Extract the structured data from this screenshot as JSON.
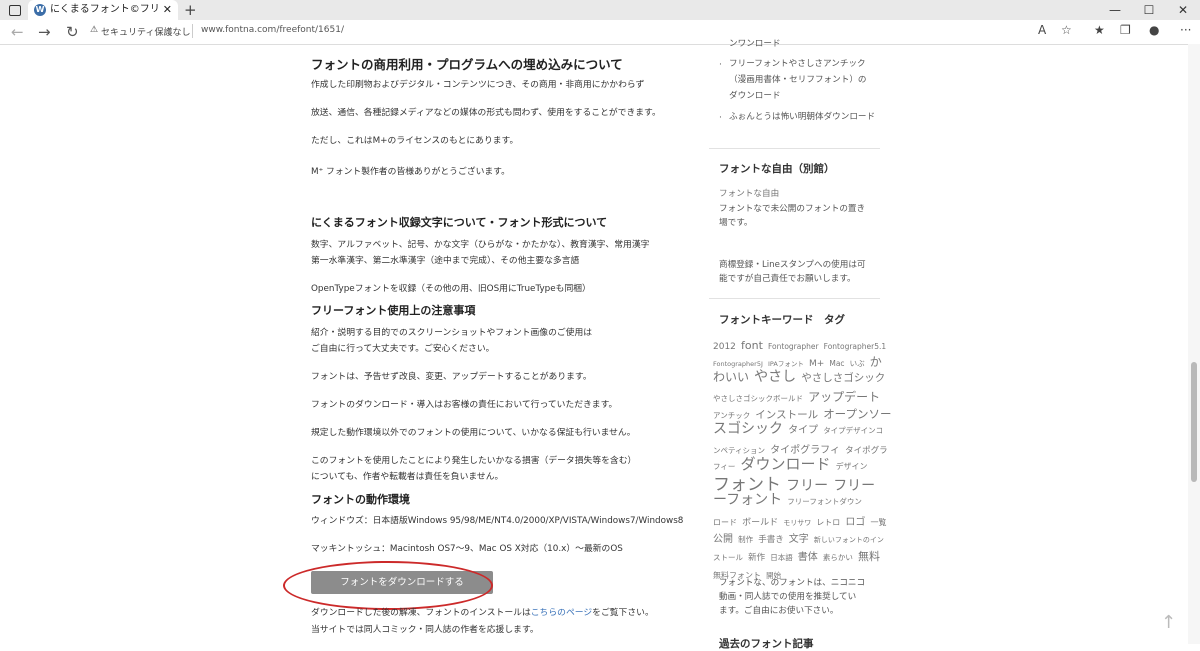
{
  "browser": {
    "tab_title": "にくまるフォント©フリーフォントダウンロ",
    "tab_close": "✕",
    "new_tab": "+",
    "security_label": "セキュリティ保護なし",
    "url": "www.fontna.com/freefont/1651/",
    "window_controls": [
      "—",
      "☐",
      "✕"
    ]
  },
  "main": {
    "h1": "フォントの商用利用・プログラムへの埋め込みについて",
    "p1": "作成した印刷物およびデジタル・コンテンツにつき、その商用・非商用にかかわらず",
    "p2": "放送、通信、各種記録メディアなどの媒体の形式も問わず、使用をすることができます。",
    "p3": "ただし、これはM+のライセンスのもとにあります。",
    "p4": "M⁺ フォント製作者の皆様ありがとうございます。",
    "h2": "にくまるフォント収録文字について・フォント形式について",
    "p5a": "数字、アルファベット、記号、かな文字（ひらがな・かたかな）、教育漢字、常用漢字",
    "p5b": "第一水準漢字、第二水準漢字（途中まで完成）、その他主要な多言語",
    "p6": "OpenTypeフォントを収録（その他の用、旧OS用にTrueTypeも同梱）",
    "h3": "フリーフォント使用上の注意事項",
    "p7a": "紹介・説明する目的でのスクリーンショットやフォント画像のご使用は",
    "p7b": "ご自由に行って大丈夫です。ご安心ください。",
    "p8": "フォントは、予告せず改良、変更、アップデートすることがあります。",
    "p9": "フォントのダウンロード・導入はお客様の責任において行っていただきます。",
    "p10": "規定した動作環境以外でのフォントの使用について、いかなる保証も行いません。",
    "p11a": "このフォントを使用したことにより発生したいかなる損害（データ損失等を含む）",
    "p11b": "についても、作者や転載者は責任を負いません。",
    "h4": "フォントの動作環境",
    "p12": "ウィンドウズ：日本語版Windows 95/98/ME/NT4.0/2000/XP/VISTA/Windows7/Windows8",
    "p13": "マッキントッシュ：Macintosh OS7～9、Mac OS X対応（10.x）～最新のOS",
    "download_button": "フォントをダウンロードする",
    "p14_pre": "ダウンロードした後の解凍、フォントのインストールは",
    "p14_link": "こちらのページ",
    "p14_post": "をご覧下さい。",
    "p15": "当サイトでは同人コミック・同人誌の作者を応援します。"
  },
  "sidebar": {
    "top_cut": "ンワンロード",
    "link1a": "フリーフォントやさしさアンチック",
    "link1b": "（漫画用書体・セリフフォント）の",
    "link1c": "ダウンロード",
    "link2": "ふぉんとうは怖い明朝体ダウンロード",
    "h_free": "フォントな自由（別館）",
    "free1": "フォントな自由",
    "free2a": "フォントなで未公開のフォントの置き",
    "free2b": "場です。",
    "trademark_a": "商標登録・Lineスタンプへの使用は可",
    "trademark_b": "能ですが自己責任でお願いします。",
    "h_tags": "フォントキーワード　タグ",
    "tags": [
      "2012",
      "font",
      "Fontographer",
      "Fontographer5.1",
      "Fontographer5J",
      "IPAフォント",
      "M+",
      "Mac",
      "いぶ",
      "か",
      "わいい",
      "やさし",
      "やさしさゴシック",
      "やさしさゴシックボールド",
      "アップデート",
      "アンチック",
      "インストール",
      "オープンソー",
      "スゴシック",
      "タイプ",
      "タイプデザインコ",
      "ンペティション",
      "タイポグラフィ",
      "タイポグラ",
      "フィー",
      "ダウンロード",
      "デザイン",
      "フォント",
      "フリー",
      "フリー",
      "ーフォント",
      "フリーフォントダウン",
      "ロード",
      "ボールド",
      "モリサワ",
      "レトロ",
      "ロゴ",
      "一覧",
      "公開",
      "制作",
      "手書き",
      "文字",
      "新しいフォントのイン",
      "ストール",
      "新作",
      "日本語",
      "書体",
      "素らかい",
      "無料",
      "無料フォント",
      "開始"
    ],
    "nico_a": "フォントな、のフォントは、ニコニコ",
    "nico_b": "動画・同人誌での使用を推奨してい",
    "nico_c": "ます。ご自由にお使い下さい。",
    "h_past": "過去のフォント記事"
  }
}
